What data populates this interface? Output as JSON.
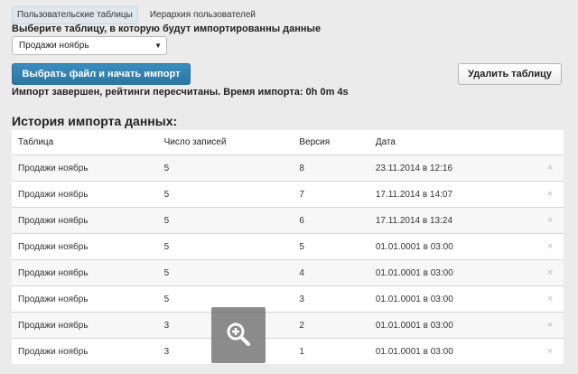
{
  "tabs": [
    {
      "label": "Пользовательские таблицы",
      "active": true
    },
    {
      "label": "Иерархия пользователей",
      "active": false
    }
  ],
  "table_select": {
    "label": "Выберите таблицу, в которую будут импортированны данные",
    "value": "Продажи ноябрь"
  },
  "actions": {
    "import_button": "Выбрать файл и начать импорт",
    "delete_table_button": "Удалить таблицу"
  },
  "import_status": "Импорт завершен, рейтинги пересчитаны. Время импорта: 0h 0m 4s",
  "history": {
    "title": "История импорта данных:",
    "columns": [
      "Таблица",
      "Число записей",
      "Версия",
      "Дата"
    ],
    "rows": [
      {
        "table": "Продажи ноябрь",
        "count": "5",
        "version": "8",
        "date": "23.11.2014 в 12:16"
      },
      {
        "table": "Продажи ноябрь",
        "count": "5",
        "version": "7",
        "date": "17.11.2014 в 14:07"
      },
      {
        "table": "Продажи ноябрь",
        "count": "5",
        "version": "6",
        "date": "17.11.2014 в 13:24"
      },
      {
        "table": "Продажи ноябрь",
        "count": "5",
        "version": "5",
        "date": "01.01.0001 в 03:00"
      },
      {
        "table": "Продажи ноябрь",
        "count": "5",
        "version": "4",
        "date": "01.01.0001 в 03:00"
      },
      {
        "table": "Продажи ноябрь",
        "count": "5",
        "version": "3",
        "date": "01.01.0001 в 03:00"
      },
      {
        "table": "Продажи ноябрь",
        "count": "3",
        "version": "2",
        "date": "01.01.0001 в 03:00"
      },
      {
        "table": "Продажи ноябрь",
        "count": "3",
        "version": "1",
        "date": "01.01.0001 в 03:00"
      }
    ],
    "delete_glyph": "×"
  },
  "icons": {
    "select_arrow": "chevron-down-icon",
    "row_delete": "close-icon",
    "zoom": "zoom-in-icon"
  },
  "colors": {
    "primary_button": "#2c76a3",
    "page_background": "#ebebeb",
    "active_tab": "#dfe7ee"
  }
}
